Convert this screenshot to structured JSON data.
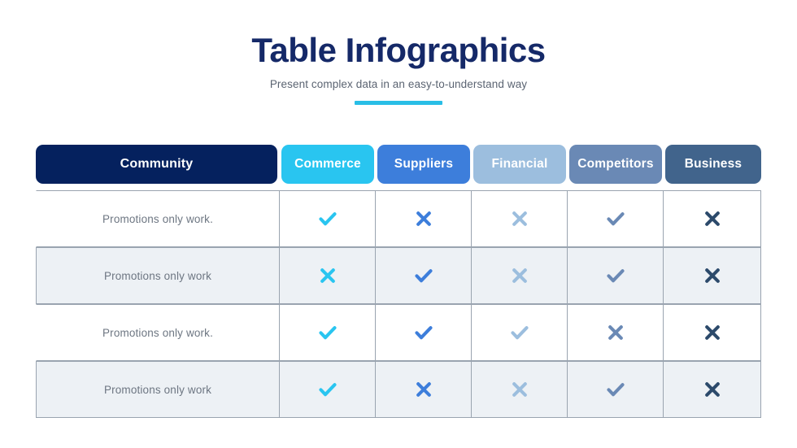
{
  "header": {
    "title": "Table Infographics",
    "subtitle": "Present complex data in an easy-to-understand way",
    "accent_color": "#29bee6",
    "title_color": "#152968"
  },
  "table": {
    "columns": [
      {
        "label": "Community",
        "color": "#05215e"
      },
      {
        "label": "Commerce",
        "color": "#29c5f0"
      },
      {
        "label": "Suppliers",
        "color": "#3d7edb"
      },
      {
        "label": "Financial",
        "color": "#9cbede"
      },
      {
        "label": "Competitors",
        "color": "#6a89b5"
      },
      {
        "label": "Business",
        "color": "#41648c"
      }
    ],
    "row_alt_background": "#edf1f5",
    "row_border_color": "#9aa4b0",
    "label_text_color": "#6d7682",
    "rows": [
      {
        "label": "Promotions only work.",
        "shaded": false,
        "cells": [
          {
            "icon": "check-icon",
            "color": "#29c5f0"
          },
          {
            "icon": "cross-icon",
            "color": "#3d7edb"
          },
          {
            "icon": "cross-icon",
            "color": "#9cbede"
          },
          {
            "icon": "check-icon",
            "color": "#6a89b5"
          },
          {
            "icon": "cross-icon",
            "color": "#2c4a6b"
          }
        ]
      },
      {
        "label": "Promotions only work",
        "shaded": true,
        "cells": [
          {
            "icon": "cross-icon",
            "color": "#29c5f0"
          },
          {
            "icon": "check-icon",
            "color": "#3d7edb"
          },
          {
            "icon": "cross-icon",
            "color": "#9cbede"
          },
          {
            "icon": "check-icon",
            "color": "#6a89b5"
          },
          {
            "icon": "cross-icon",
            "color": "#2c4a6b"
          }
        ]
      },
      {
        "label": "Promotions only work.",
        "shaded": false,
        "cells": [
          {
            "icon": "check-icon",
            "color": "#29c5f0"
          },
          {
            "icon": "check-icon",
            "color": "#3d7edb"
          },
          {
            "icon": "check-icon",
            "color": "#9cbede"
          },
          {
            "icon": "cross-icon",
            "color": "#6a89b5"
          },
          {
            "icon": "cross-icon",
            "color": "#2c4a6b"
          }
        ]
      },
      {
        "label": "Promotions only work",
        "shaded": true,
        "cells": [
          {
            "icon": "check-icon",
            "color": "#29c5f0"
          },
          {
            "icon": "cross-icon",
            "color": "#3d7edb"
          },
          {
            "icon": "cross-icon",
            "color": "#9cbede"
          },
          {
            "icon": "check-icon",
            "color": "#6a89b5"
          },
          {
            "icon": "cross-icon",
            "color": "#2c4a6b"
          }
        ]
      }
    ]
  }
}
